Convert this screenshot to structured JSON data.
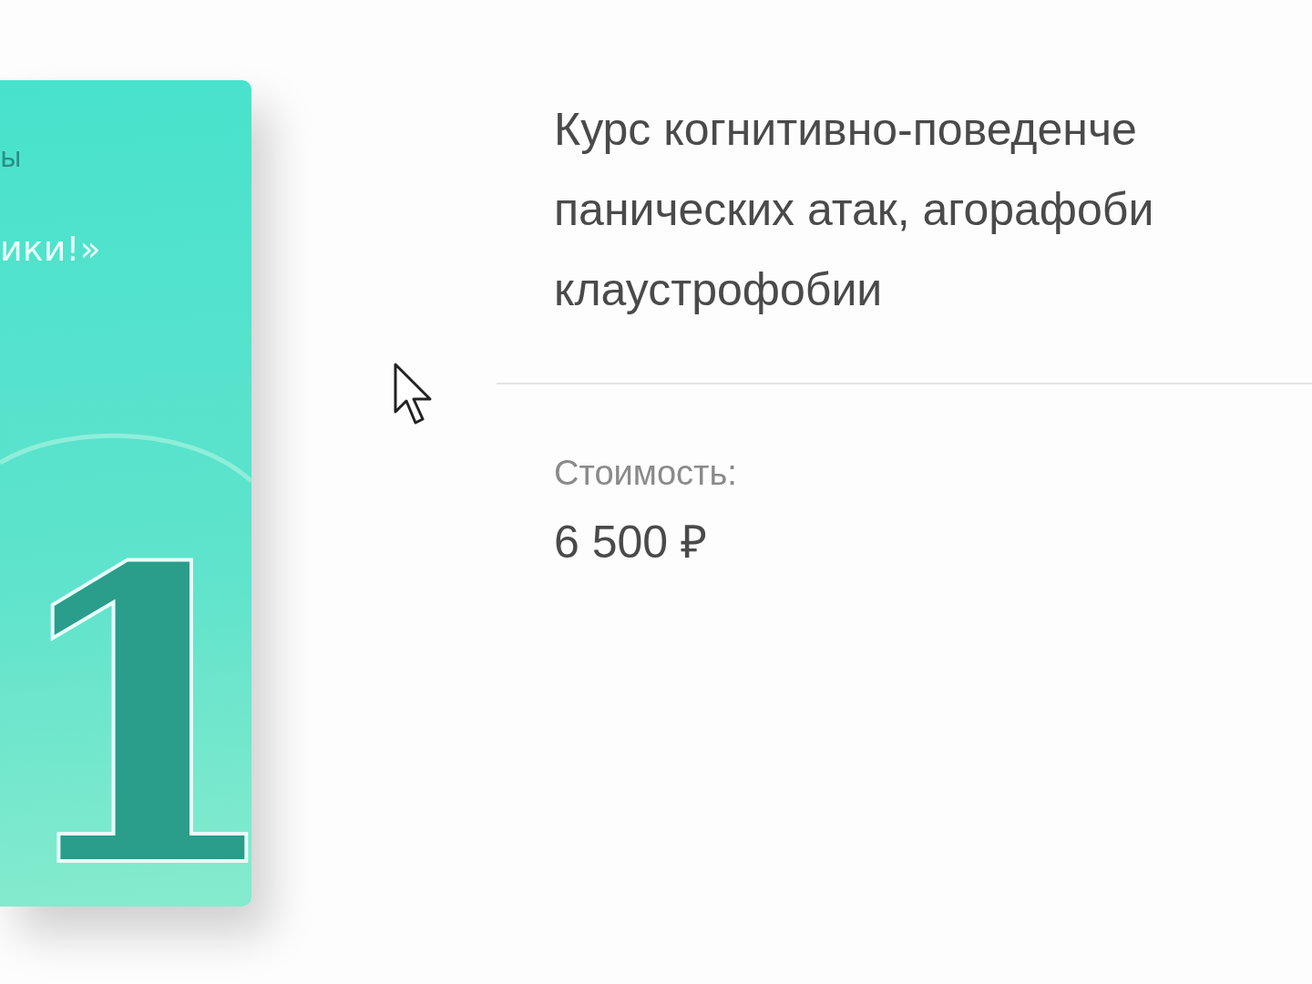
{
  "cover": {
    "top_text": "ы",
    "headline": "ики!»",
    "numeral": "1"
  },
  "course": {
    "title_lines": [
      "Курс когнитивно-поведенче",
      "панических атак, агорафоби",
      "клаустрофобии"
    ],
    "price_label": "Стоимость:",
    "price": "6 500 ₽"
  }
}
